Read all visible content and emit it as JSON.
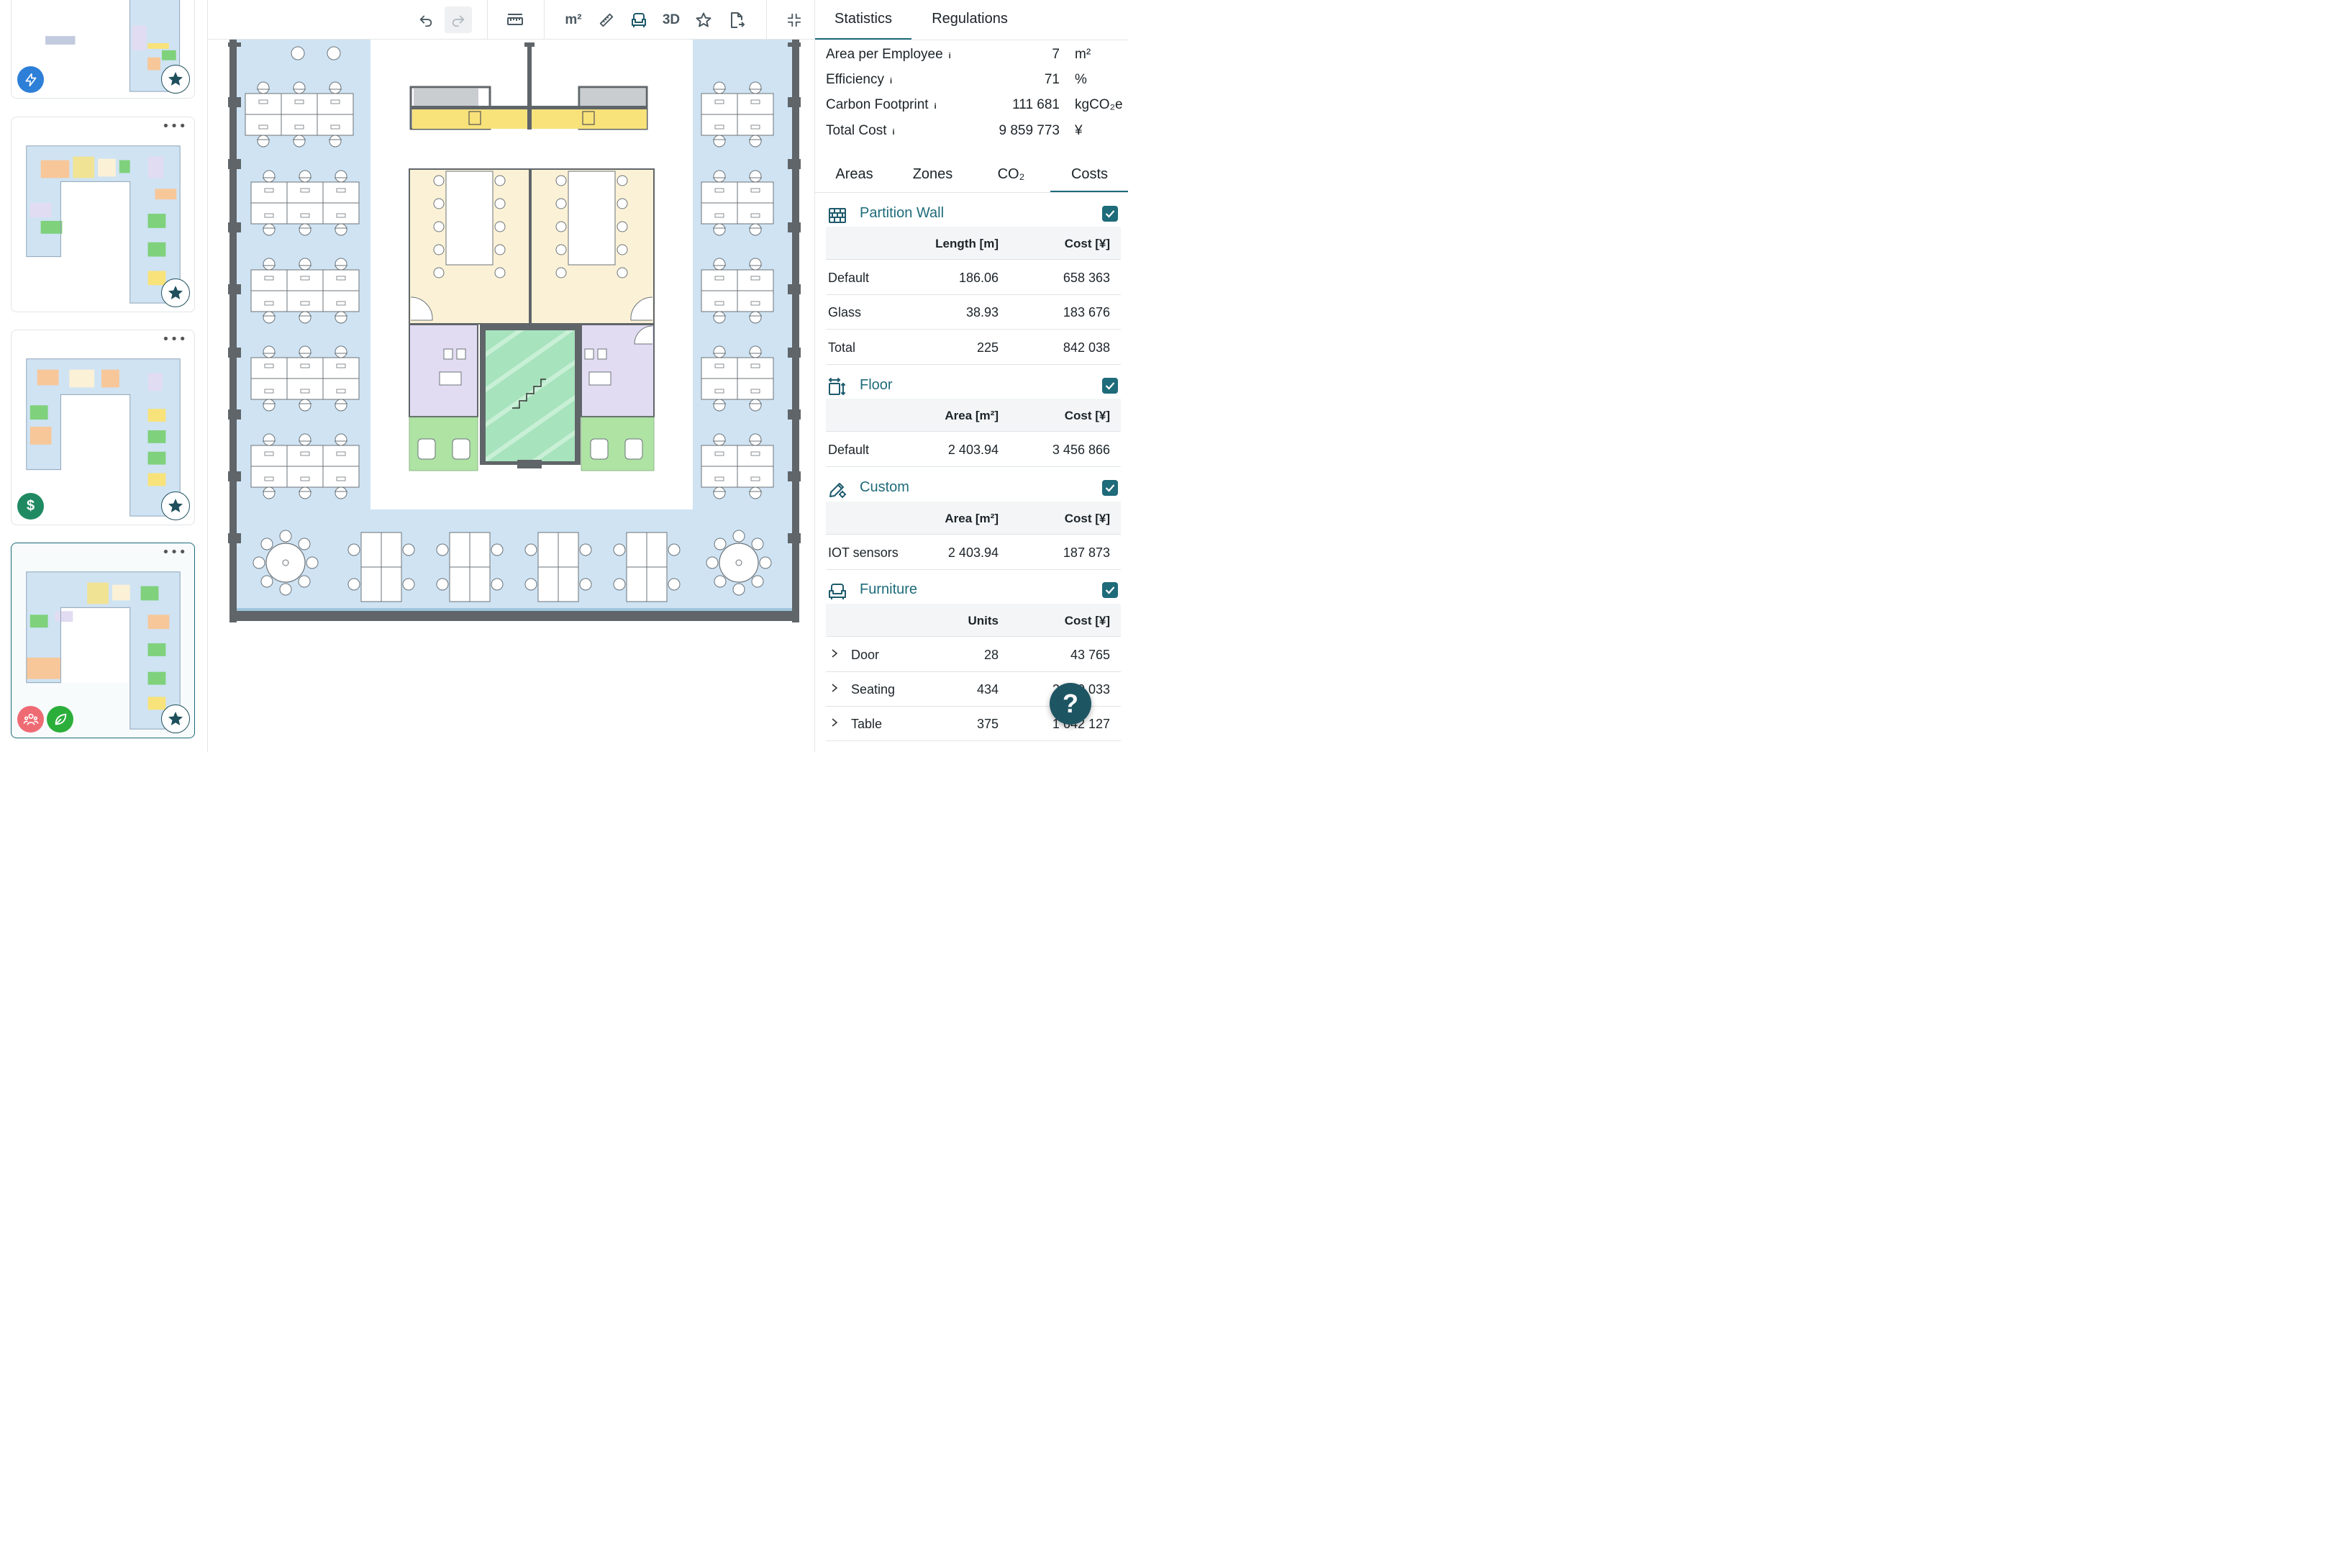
{
  "toolbar": {
    "area_unit_label": "m²",
    "view_3d_label": "3D"
  },
  "panel": {
    "tabs": [
      {
        "label": "Statistics",
        "active": true
      },
      {
        "label": "Regulations",
        "active": false
      }
    ],
    "stats": [
      {
        "label": "Area per Employee",
        "value": "7",
        "unit": "m²"
      },
      {
        "label": "Efficiency",
        "value": "71",
        "unit": "%"
      },
      {
        "label": "Carbon Footprint",
        "value": "111 681",
        "unit": "kgCO₂e"
      },
      {
        "label": "Total Cost",
        "value": "9 859 773",
        "unit": "¥"
      }
    ],
    "info_glyph": "i",
    "subtabs": [
      {
        "label": "Areas",
        "active": false
      },
      {
        "label": "Zones",
        "active": false
      },
      {
        "label": "CO₂",
        "active": false
      },
      {
        "label": "Costs",
        "active": true
      }
    ],
    "sections": {
      "partition_wall": {
        "title": "Partition Wall",
        "col2": "Length [m]",
        "col3": "Cost [¥]",
        "rows": [
          {
            "name": "Default",
            "v1": "186.06",
            "v2": "658 363"
          },
          {
            "name": "Glass",
            "v1": "38.93",
            "v2": "183 676"
          },
          {
            "name": "Total",
            "v1": "225",
            "v2": "842 038"
          }
        ]
      },
      "floor": {
        "title": "Floor",
        "col2": "Area [m²]",
        "col3": "Cost [¥]",
        "rows": [
          {
            "name": "Default",
            "v1": "2 403.94",
            "v2": "3 456 866"
          }
        ]
      },
      "custom": {
        "title": "Custom",
        "col2": "Area [m²]",
        "col3": "Cost [¥]",
        "rows": [
          {
            "name": "IOT sensors",
            "v1": "2 403.94",
            "v2": "187 873"
          }
        ]
      },
      "furniture": {
        "title": "Furniture",
        "col2": "Units",
        "col3": "Cost [¥]",
        "rows": [
          {
            "name": "Door",
            "v1": "28",
            "v2": "43 765"
          },
          {
            "name": "Seating",
            "v1": "434",
            "v2": "2 070 033"
          },
          {
            "name": "Table",
            "v1": "375",
            "v2": "1 642 127"
          }
        ]
      }
    }
  },
  "sidebar": {
    "menu_glyph": "•••",
    "badges": {
      "energy": "lightning-icon",
      "cost": "$",
      "people": "people-icon",
      "eco": "leaf-icon"
    }
  },
  "help_label": "?",
  "colors": {
    "accent": "#1e6b7a",
    "work_area": "#cfe3f3",
    "meeting": "#fbf1d6",
    "phone_booth": "#e2dcf2",
    "lounge": "#aee3a4",
    "stairs": "#a7e3bd",
    "kitchen": "#f8e27a"
  }
}
